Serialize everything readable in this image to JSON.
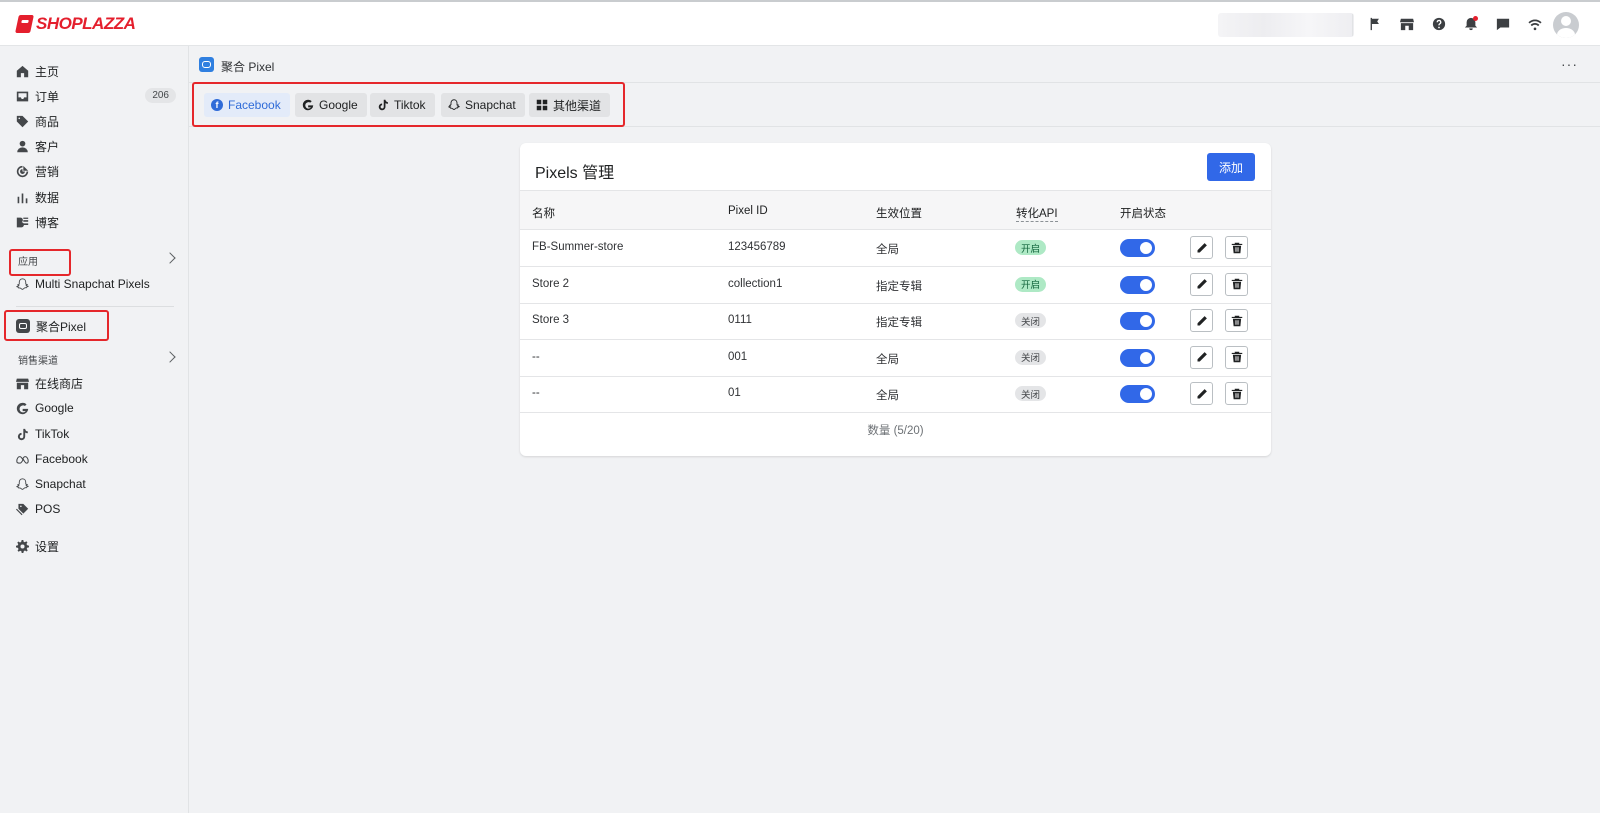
{
  "brand": {
    "name": "SHOPLAZZA",
    "color": "#e41f2d"
  },
  "topbar": {
    "icons": [
      "flag-icon",
      "store-icon",
      "help-icon",
      "bell-icon",
      "chat-icon",
      "wifi-icon"
    ],
    "avatar": "avatar"
  },
  "sidebar": {
    "items": [
      {
        "label": "主页",
        "icon": "home-icon"
      },
      {
        "label": "订单",
        "icon": "inbox-icon",
        "badge": "206"
      },
      {
        "label": "商品",
        "icon": "tag-icon"
      },
      {
        "label": "客户",
        "icon": "person-icon"
      },
      {
        "label": "营销",
        "icon": "target-icon"
      },
      {
        "label": "数据",
        "icon": "bar-chart-icon"
      },
      {
        "label": "博客",
        "icon": "blog-icon"
      }
    ],
    "apps_section": "应用",
    "apps": [
      {
        "label": "Multi Snapchat Pixels",
        "icon": "snapchat-icon"
      },
      {
        "label": "聚合Pixel",
        "icon": "pixel-app-icon"
      }
    ],
    "channels_section": "销售渠道",
    "channels": [
      {
        "label": "在线商店",
        "icon": "store-icon"
      },
      {
        "label": "Google",
        "icon": "google-icon"
      },
      {
        "label": "TikTok",
        "icon": "tiktok-icon"
      },
      {
        "label": "Facebook",
        "icon": "meta-icon"
      },
      {
        "label": "Snapchat",
        "icon": "snapchat-icon"
      },
      {
        "label": "POS",
        "icon": "pos-icon"
      }
    ],
    "settings": {
      "label": "设置",
      "icon": "gear-icon"
    }
  },
  "page": {
    "title": "聚合 Pixel",
    "more": "···"
  },
  "tabs": [
    {
      "label": "Facebook",
      "icon": "facebook-icon",
      "active": true
    },
    {
      "label": "Google",
      "icon": "google-icon"
    },
    {
      "label": "Tiktok",
      "icon": "tiktok-icon"
    },
    {
      "label": "Snapchat",
      "icon": "snapchat-icon"
    },
    {
      "label": "其他渠道",
      "icon": "grid-icon"
    }
  ],
  "card": {
    "title": "Pixels 管理",
    "add_label": "添加",
    "columns": [
      "名称",
      "Pixel ID",
      "生效位置",
      "转化API",
      "开启状态"
    ],
    "rows": [
      {
        "name": "FB-Summer-store",
        "pixel_id": "123456789",
        "scope": "全局",
        "api": "开启",
        "api_on": true,
        "enabled": true
      },
      {
        "name": "Store 2",
        "pixel_id": "collection1",
        "scope": "指定专辑",
        "api": "开启",
        "api_on": true,
        "enabled": true
      },
      {
        "name": "Store 3",
        "pixel_id": "0111",
        "scope": "指定专辑",
        "api": "关闭",
        "api_on": false,
        "enabled": true
      },
      {
        "name": "--",
        "pixel_id": "001",
        "scope": "全局",
        "api": "关闭",
        "api_on": false,
        "enabled": true
      },
      {
        "name": "--",
        "pixel_id": "01",
        "scope": "全局",
        "api": "关闭",
        "api_on": false,
        "enabled": true
      }
    ],
    "footer": "数量 (5/20)"
  },
  "colors": {
    "accent": "#3168e8",
    "highlight": "#e5272b",
    "badge_on": "#aee9c5"
  }
}
